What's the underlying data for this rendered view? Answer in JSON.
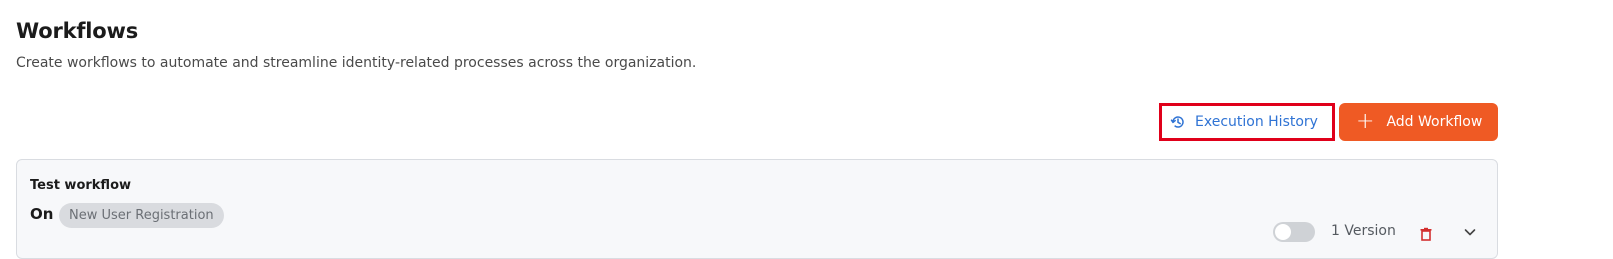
{
  "header": {
    "title": "Workflows",
    "subtitle": "Create workflows to automate and streamline identity-related processes across the organization."
  },
  "actions": {
    "execution_history_label": "Execution History",
    "execution_history_icon": "history-icon",
    "add_workflow_label": "Add Workflow",
    "add_workflow_icon": "plus-icon",
    "highlight_color": "#e0001a",
    "accent_color": "#ef5a24",
    "link_color": "#2f73d4"
  },
  "workflows": [
    {
      "name": "Test workflow",
      "trigger_prefix": "On",
      "trigger": "New User Registration",
      "enabled": false,
      "versions": "1 Version",
      "delete_icon": "trash-icon",
      "expand_icon": "chevron-down-icon"
    }
  ]
}
